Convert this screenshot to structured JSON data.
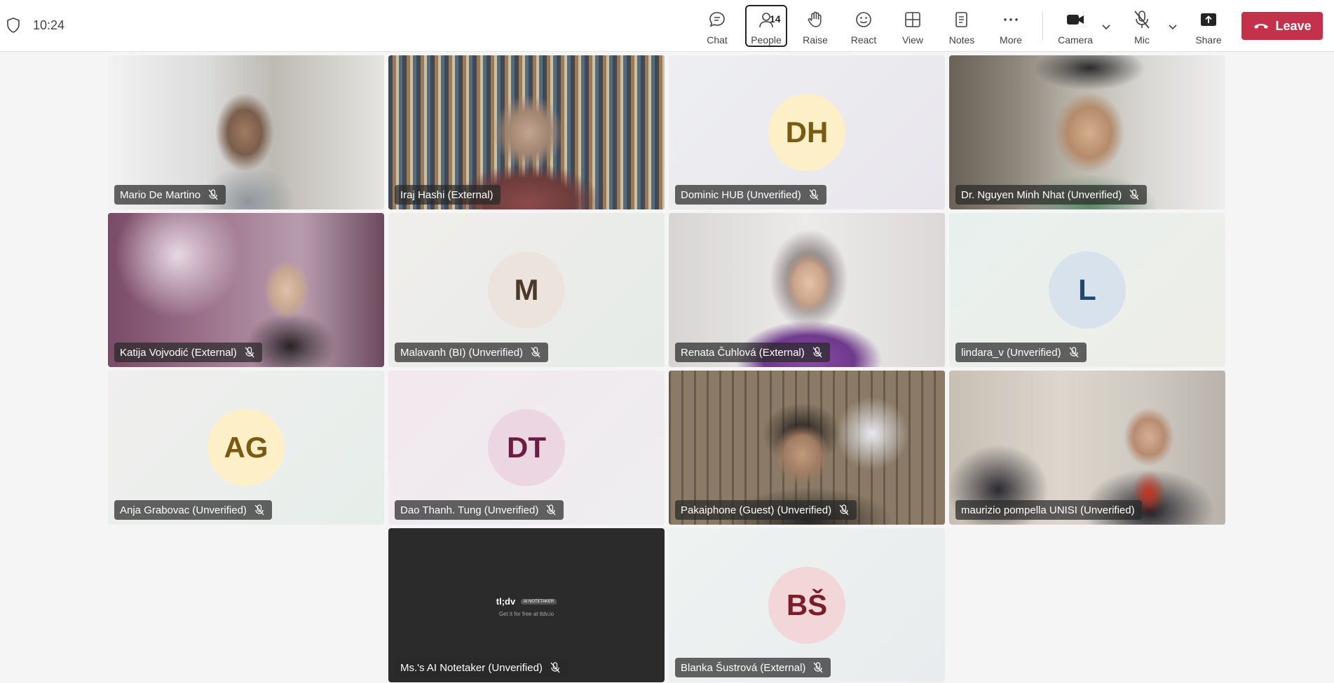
{
  "status": {
    "time": "10:24",
    "shield_icon": "shield-icon"
  },
  "toolbar": {
    "chat": "Chat",
    "people": "People",
    "people_count": "14",
    "raise": "Raise",
    "react": "React",
    "view": "View",
    "notes": "Notes",
    "more": "More",
    "camera": "Camera",
    "mic": "Mic",
    "share": "Share",
    "leave": "Leave"
  },
  "colors": {
    "leave": "#c4314b",
    "speaking_outline": "#5b5fc7"
  },
  "participants": [
    {
      "name": "Mario De Martino",
      "type": "video",
      "muted": true
    },
    {
      "name": "Iraj Hashi (External)",
      "type": "video",
      "speaking": true
    },
    {
      "name": "Dominic HUB (Unverified)",
      "type": "avatar",
      "initials": "DH",
      "avatar_bg": "#fdf0c8",
      "avatar_fg": "#7a5a12",
      "muted": true
    },
    {
      "name": "Dr. Nguyen Minh Nhat (Unverified)",
      "type": "video",
      "muted": true
    },
    {
      "name": "Katija Vojvodić (External)",
      "type": "video",
      "muted": true
    },
    {
      "name": "Malavanh (BI) (Unverified)",
      "type": "avatar",
      "initials": "M",
      "avatar_bg": "#ece4dc",
      "avatar_fg": "#4a3a2c",
      "muted": true
    },
    {
      "name": "Renata Čuhlová (External)",
      "type": "video",
      "muted": true
    },
    {
      "name": "lindara_v (Unverified)",
      "type": "avatar",
      "initials": "L",
      "avatar_bg": "#d8e2ec",
      "avatar_fg": "#24466a",
      "muted": true
    },
    {
      "name": "Anja Grabovac (Unverified)",
      "type": "avatar",
      "initials": "AG",
      "avatar_bg": "#fdf0c8",
      "avatar_fg": "#7a5a12",
      "muted": true
    },
    {
      "name": "Dao Thanh. Tung (Unverified)",
      "type": "avatar",
      "initials": "DT",
      "avatar_bg": "#ecd6e2",
      "avatar_fg": "#6a1e44",
      "muted": true
    },
    {
      "name": "Pakaiphone (Guest) (Unverified)",
      "type": "video",
      "muted": true
    },
    {
      "name": "maurizio pompella UNISI (Unverified)",
      "type": "video",
      "muted": false
    },
    {
      "name": "Ms.'s AI Notetaker (Unverified)",
      "type": "notetaker",
      "muted": true,
      "brand": "tl;dv",
      "brand_pill": "AI NOTETAKER",
      "brand_sub": "Get it for free at tldv.io"
    },
    {
      "name": "Blanka Šustrová (External)",
      "type": "avatar",
      "initials": "BŠ",
      "avatar_bg": "#f3d6d8",
      "avatar_fg": "#7a1f2a",
      "muted": true
    }
  ]
}
